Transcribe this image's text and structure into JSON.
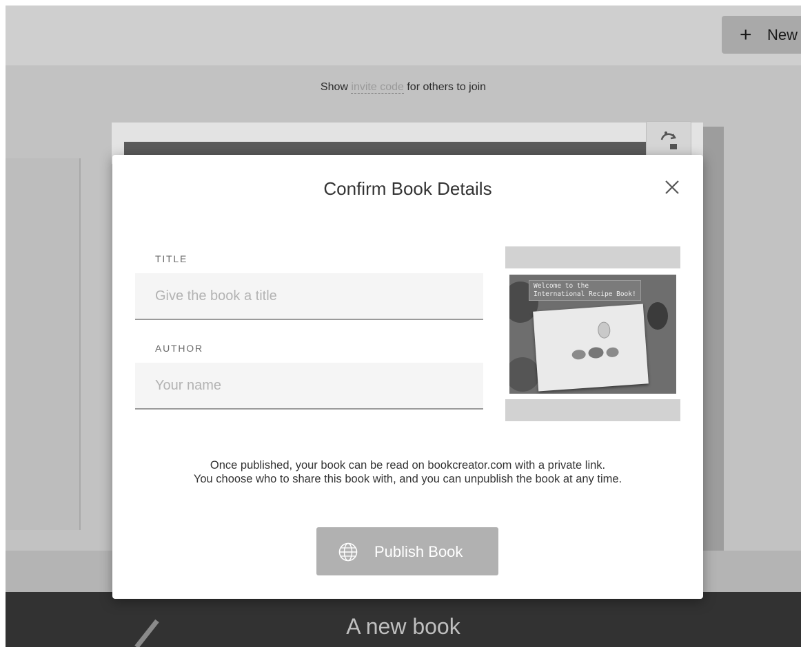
{
  "header": {
    "new_button_plus": "+",
    "new_button_label": "New"
  },
  "invite": {
    "prefix": "Show",
    "code_link": "invite code",
    "suffix": "for others to join"
  },
  "bottom_bar": {
    "book_name": "A new book"
  },
  "modal": {
    "title": "Confirm Book Details",
    "close_icon": "close-icon",
    "title_field": {
      "label": "TITLE",
      "placeholder": "Give the book a title",
      "value": ""
    },
    "author_field": {
      "label": "AUTHOR",
      "placeholder": "Your name",
      "value": ""
    },
    "cover_preview": {
      "caption": "Welcome to the\nInternational Recipe Book!"
    },
    "disclaimer_line1": "Once published, your book can be read on bookcreator.com with a private link.",
    "disclaimer_line2": "You choose who to share this book with, and you can unpublish the book at any time.",
    "publish_button": {
      "label": "Publish Book",
      "icon": "globe-icon"
    }
  }
}
